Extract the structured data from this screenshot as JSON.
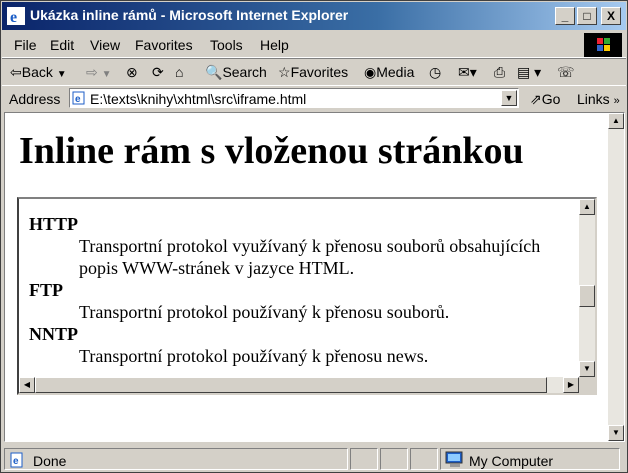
{
  "window": {
    "title": "Ukázka inline rámů - Microsoft Internet Explorer",
    "minimize": "_",
    "maximize": "□",
    "close": "X"
  },
  "menu": [
    "File",
    "Edit",
    "View",
    "Favorites",
    "Tools",
    "Help"
  ],
  "toolbar": {
    "back": "Back",
    "search": "Search",
    "favorites": "Favorites",
    "media": "Media"
  },
  "address": {
    "label": "Address",
    "url": "E:\\texts\\knihy\\xhtml\\src\\iframe.html",
    "go": "Go",
    "links": "Links"
  },
  "page": {
    "heading": "Inline rám s vloženou stránkou"
  },
  "iframe": {
    "items": [
      {
        "term": "HTTP",
        "desc1": "Transportní protokol využívaný k přenosu souborů obsahujících",
        "desc2": "popis WWW-stránek v jazyce HTML."
      },
      {
        "term": "FTP",
        "desc1": "Transportní protokol používaný k přenosu souborů."
      },
      {
        "term": "NNTP",
        "desc1": "Transportní protokol používaný k přenosu news."
      }
    ]
  },
  "status": {
    "text": "Done",
    "zone": "My Computer"
  },
  "colors": {
    "titlebar_start": "#0a246a",
    "titlebar_end": "#a6caf0",
    "chrome": "#d4d0c8"
  }
}
